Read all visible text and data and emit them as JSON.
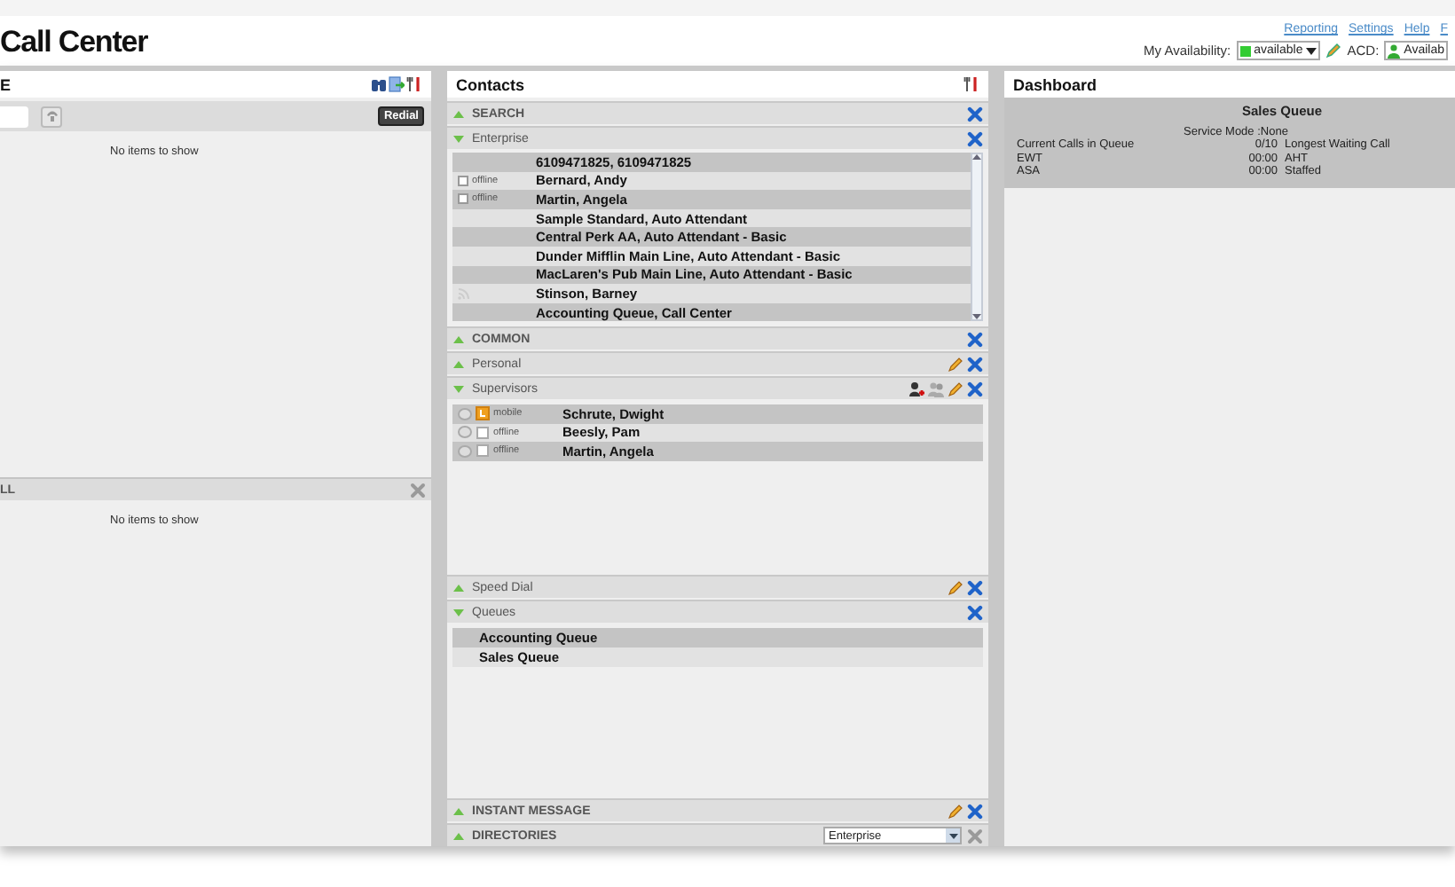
{
  "header": {
    "title": "Call Center",
    "links": [
      "Reporting",
      "Settings",
      "Help",
      "F"
    ],
    "availability": {
      "label": "My Availability:",
      "value": "available"
    },
    "acd": {
      "label": "ACD:",
      "value": "Availab"
    }
  },
  "left_panel": {
    "title": "E",
    "redial": "Redial",
    "empty_text": "No items to show",
    "call_section": {
      "title": "LL",
      "empty_text": "No items to show"
    }
  },
  "contacts": {
    "title": "Contacts",
    "sections": [
      {
        "kind": "plain",
        "title": "SEARCH",
        "expanded": false,
        "actions": [
          {
            "kind": "close"
          }
        ]
      },
      {
        "kind": "directory",
        "title": "Enterprise",
        "expanded": true,
        "actions": [
          {
            "kind": "close"
          }
        ],
        "rows": [
          {
            "kind": "plain",
            "name": "6109471825, 6109471825"
          },
          {
            "kind": "contact",
            "status": "offline",
            "checked": false,
            "name": "Bernard, Andy"
          },
          {
            "kind": "contact",
            "status": "offline",
            "checked": false,
            "name": "Martin, Angela"
          },
          {
            "kind": "plain",
            "name": "Sample Standard, Auto Attendant"
          },
          {
            "kind": "plain",
            "name": "Central Perk AA, Auto Attendant - Basic"
          },
          {
            "kind": "plain",
            "name": "Dunder Mifflin Main Line, Auto Attendant - Basic"
          },
          {
            "kind": "plain",
            "name": "MacLaren's Pub Main Line, Auto Attendant - Basic"
          },
          {
            "kind": "feed",
            "name": "Stinson, Barney"
          },
          {
            "kind": "plain",
            "name": "Accounting Queue, Call Center"
          }
        ]
      },
      {
        "kind": "plain",
        "title": "COMMON",
        "expanded": false,
        "actions": [
          {
            "kind": "close"
          }
        ]
      },
      {
        "kind": "plain",
        "title": "Personal",
        "expanded": false,
        "actions": [
          {
            "kind": "edit"
          },
          {
            "kind": "close"
          }
        ]
      },
      {
        "kind": "supervisors",
        "title": "Supervisors",
        "expanded": true,
        "actions": [
          {
            "kind": "add-person"
          },
          {
            "kind": "group"
          },
          {
            "kind": "edit"
          },
          {
            "kind": "close"
          }
        ],
        "rows": [
          {
            "status": "mobile",
            "name": "Schrute, Dwight",
            "selected": false
          },
          {
            "status": "offline",
            "name": "Beesly, Pam",
            "selected": false
          },
          {
            "status": "offline",
            "name": "Martin, Angela",
            "selected": false
          }
        ]
      },
      {
        "kind": "plain",
        "title": "Speed Dial",
        "expanded": false,
        "actions": [
          {
            "kind": "edit"
          },
          {
            "kind": "close"
          }
        ]
      },
      {
        "kind": "queues",
        "title": "Queues",
        "expanded": true,
        "actions": [
          {
            "kind": "close"
          }
        ],
        "rows": [
          {
            "name": "Accounting Queue"
          },
          {
            "name": "Sales Queue"
          }
        ]
      },
      {
        "kind": "plain",
        "title": "INSTANT MESSAGE",
        "expanded": false,
        "actions": [
          {
            "kind": "edit"
          },
          {
            "kind": "close"
          }
        ]
      },
      {
        "kind": "plain",
        "title": "DIRECTORIES",
        "expanded": false,
        "actions": [
          {
            "kind": "close-disabled"
          }
        ],
        "select": "Enterprise"
      }
    ]
  },
  "dashboard": {
    "title": "Dashboard",
    "queue_title": "Sales Queue",
    "service_mode": "Service Mode :None",
    "stats": [
      {
        "label": "Current Calls in Queue",
        "value": "0/10",
        "label2": "Longest Waiting Call"
      },
      {
        "label": "EWT",
        "value": "00:00",
        "label2": "AHT"
      },
      {
        "label": "ASA",
        "value": "00:00",
        "label2": "Staffed"
      }
    ]
  }
}
